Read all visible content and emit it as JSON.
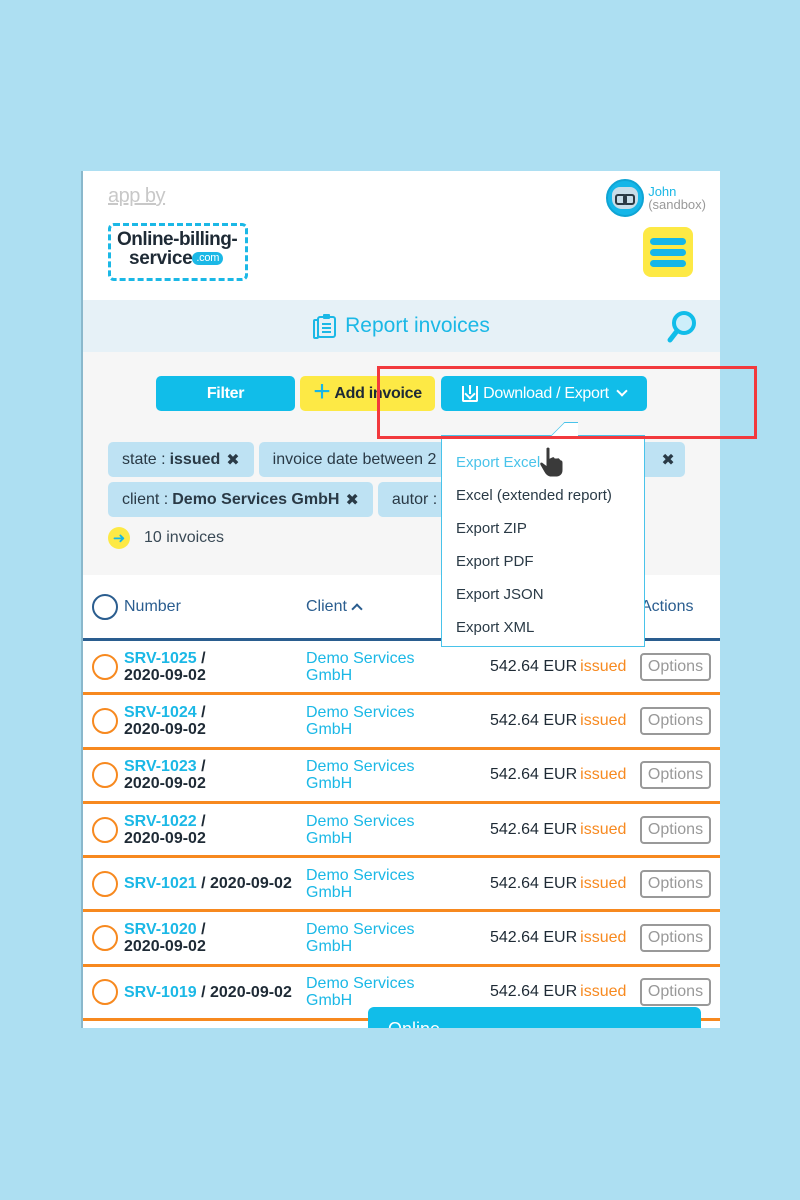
{
  "header": {
    "app_by": "app by",
    "logo_line1": "Online-billing-",
    "logo_line2": "service",
    "logo_com": ".com",
    "user_name": "John",
    "user_role": "(sandbox)"
  },
  "titlebar": {
    "title": "Report invoices"
  },
  "toolbar": {
    "filter_label": "Filter",
    "add_label": "Add invoice",
    "export_label": "Download / Export"
  },
  "filters": [
    {
      "key": "state :",
      "value": "issued"
    },
    {
      "key": "invoice date between 2",
      "value": ""
    },
    {
      "key": "client :",
      "value": "Demo Services GmbH"
    },
    {
      "key": "autor : J",
      "value": ""
    }
  ],
  "count_label": "10 invoices",
  "export_menu": {
    "items": [
      {
        "label": "Export Excel",
        "active": true
      },
      {
        "label": "Excel (extended report)"
      },
      {
        "label": "Export ZIP"
      },
      {
        "label": "Export PDF"
      },
      {
        "label": "Export JSON"
      },
      {
        "label": "Export XML"
      }
    ]
  },
  "table": {
    "columns": {
      "number": "Number",
      "client": "Client",
      "actions": "Actions"
    },
    "rows": [
      {
        "id": "SRV-1025",
        "sep": " /",
        "date": "2020-09-02",
        "client": "Demo Services GmbH",
        "amount": "542.64 EUR",
        "state": "issued",
        "action": "Options"
      },
      {
        "id": "SRV-1024",
        "sep": " /",
        "date": "2020-09-02",
        "client": "Demo Services GmbH",
        "amount": "542.64 EUR",
        "state": "issued",
        "action": "Options"
      },
      {
        "id": "SRV-1023",
        "sep": " /",
        "date": "2020-09-02",
        "client": "Demo Services GmbH",
        "amount": "542.64 EUR",
        "state": "issued",
        "action": "Options"
      },
      {
        "id": "SRV-1022",
        "sep": " /",
        "date": "2020-09-02",
        "client": "Demo Services GmbH",
        "amount": "542.64 EUR",
        "state": "issued",
        "action": "Options"
      },
      {
        "id": "SRV-1021",
        "sep": " /",
        "date": "2020-09-02",
        "client": "Demo Services GmbH",
        "amount": "542.64 EUR",
        "state": "issued",
        "action": "Options"
      },
      {
        "id": "SRV-1020",
        "sep": " /",
        "date": "2020-09-02",
        "client": "Demo Services GmbH",
        "amount": "542.64 EUR",
        "state": "issued",
        "action": "Options"
      },
      {
        "id": "SRV-1019",
        "sep": " /",
        "date": "2020-09-02",
        "client": "Demo Services GmbH",
        "amount": "542.64 EUR",
        "state": "issued",
        "action": "Options"
      }
    ]
  },
  "chat_popup": {
    "label": "Online"
  },
  "colors": {
    "page_bg": "#addff2",
    "brand_blue": "#11bde9",
    "brand_yellow": "#fde945",
    "issued_orange": "#f7891f",
    "header_navy": "#2a5d8f",
    "highlight_red": "#f2393d"
  }
}
